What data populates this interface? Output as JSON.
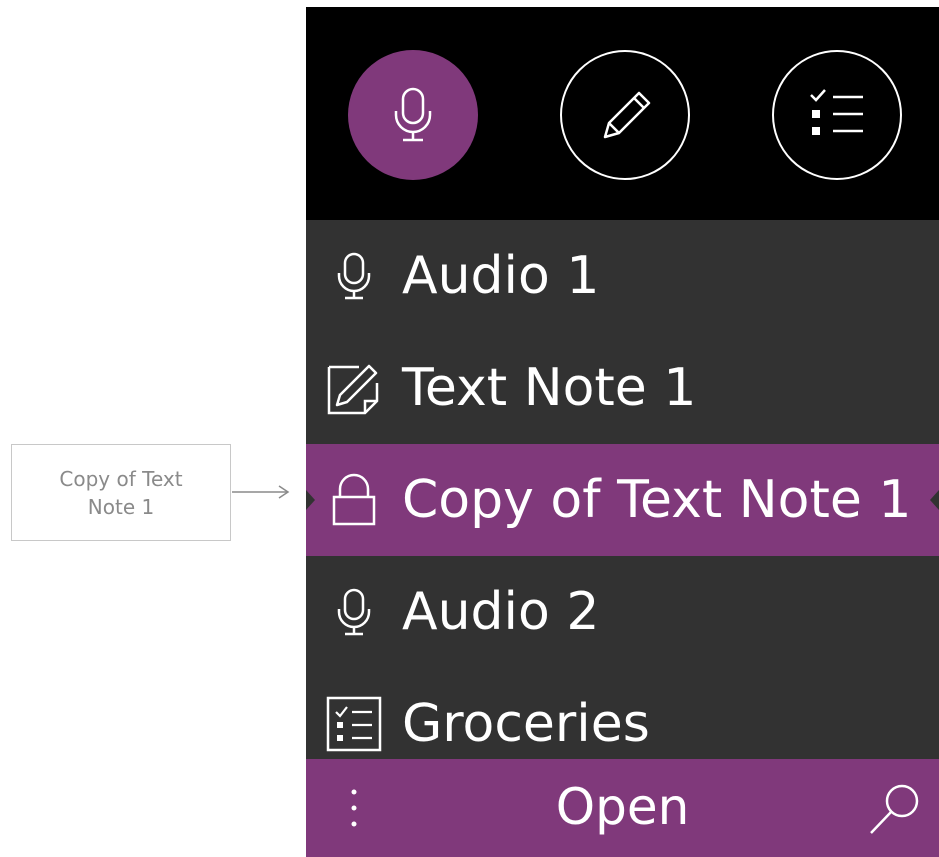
{
  "callout": {
    "text": "Copy of Text Note 1"
  },
  "toolbar": {
    "buttons": [
      {
        "name": "audio",
        "icon": "microphone-icon",
        "active": true
      },
      {
        "name": "text-note",
        "icon": "pencil-icon",
        "active": false
      },
      {
        "name": "list",
        "icon": "checklist-icon",
        "active": false
      }
    ]
  },
  "notes": {
    "items": [
      {
        "label": "Audio 1",
        "icon": "microphone-icon"
      },
      {
        "label": "Text Note 1",
        "icon": "note-edit-icon"
      },
      {
        "label": "Copy of Text Note 1",
        "icon": "lock-icon",
        "selected": true
      },
      {
        "label": "Audio 2",
        "icon": "microphone-icon"
      },
      {
        "label": "Groceries",
        "icon": "checklist-icon"
      }
    ]
  },
  "bottom_bar": {
    "action_label": "Open",
    "more_icon": "more-vertical-icon",
    "search_icon": "search-icon"
  },
  "colors": {
    "accent": "#80397b",
    "list_background": "#323232",
    "top_bar": "#000000",
    "text": "#ffffff"
  }
}
